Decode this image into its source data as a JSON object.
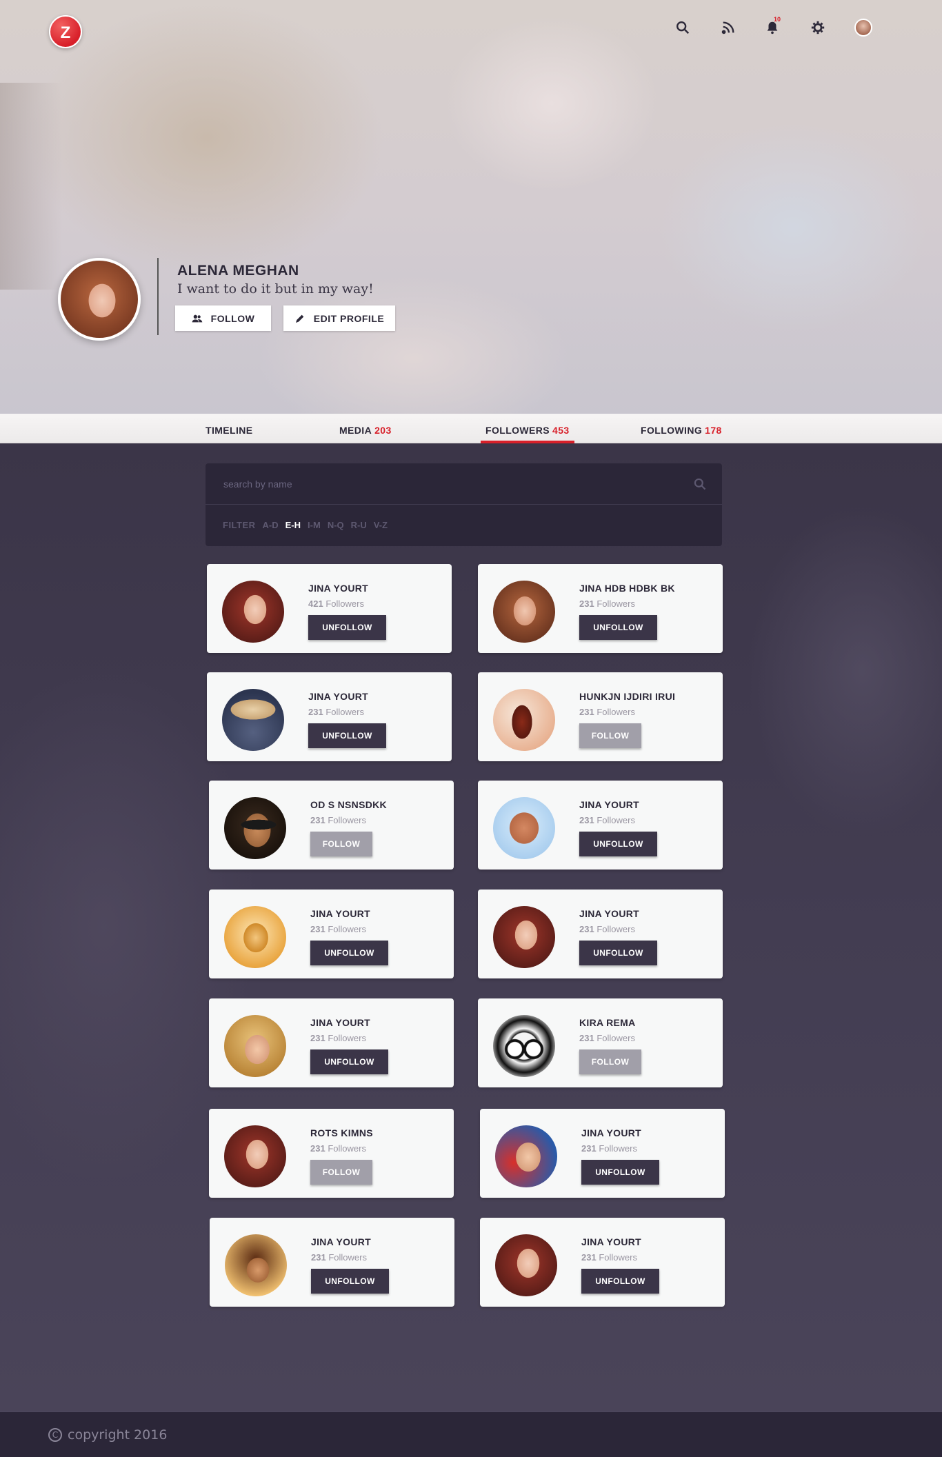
{
  "header": {
    "logo_letter": "Z",
    "notifications_count": "10",
    "icons": [
      "search-icon",
      "rss-icon",
      "bell-icon",
      "gear-icon",
      "avatar"
    ]
  },
  "profile": {
    "name": "ALENA MEGHAN",
    "tagline": "I want to do it but in my way!",
    "follow_label": "FOLLOW",
    "edit_label": "EDIT PROFILE"
  },
  "tabs": [
    {
      "label": "TIMELINE",
      "count": ""
    },
    {
      "label": "MEDIA",
      "count": "203"
    },
    {
      "label": "FOLLOWERS",
      "count": "453"
    },
    {
      "label": "FOLLOWING",
      "count": "178"
    }
  ],
  "active_tab": "FOLLOWERS",
  "search": {
    "placeholder": "search by name",
    "filter_label": "FILTER",
    "filters": [
      "A-D",
      "E-H",
      "I-M",
      "N-Q",
      "R-U",
      "V-Z"
    ],
    "active_filter": "E-H"
  },
  "followers_suffix": "Followers",
  "cards": [
    {
      "name": "JINA YOURT",
      "count": "421",
      "button": "UNFOLLOW",
      "avatar_style": "redhair"
    },
    {
      "name": "JINA HDB HDBK BK",
      "count": "231",
      "button": "UNFOLLOW",
      "avatar_style": "brown"
    },
    {
      "name": "JINA YOURT",
      "count": "231",
      "button": "UNFOLLOW",
      "avatar_style": "hat"
    },
    {
      "name": "HUNKJN IJDIRI IRUI",
      "count": "231",
      "button": "FOLLOW",
      "avatar_style": "silhouette"
    },
    {
      "name": "OD S NSNSDKK",
      "count": "231",
      "button": "FOLLOW",
      "avatar_style": "sunglasses"
    },
    {
      "name": "JINA YOURT",
      "count": "231",
      "button": "UNFOLLOW",
      "avatar_style": "hand"
    },
    {
      "name": "JINA YOURT",
      "count": "231",
      "button": "UNFOLLOW",
      "avatar_style": "golden"
    },
    {
      "name": "JINA YOURT",
      "count": "231",
      "button": "UNFOLLOW",
      "avatar_style": "redhair"
    },
    {
      "name": "JINA YOURT",
      "count": "231",
      "button": "UNFOLLOW",
      "avatar_style": "blonde"
    },
    {
      "name": "KIRA REMA",
      "count": "231",
      "button": "FOLLOW",
      "avatar_style": "sketch"
    },
    {
      "name": "ROTS KIMNS",
      "count": "231",
      "button": "FOLLOW",
      "avatar_style": "redhair"
    },
    {
      "name": "JINA YOURT",
      "count": "231",
      "button": "UNFOLLOW",
      "avatar_style": "smile"
    },
    {
      "name": "JINA YOURT",
      "count": "231",
      "button": "UNFOLLOW",
      "avatar_style": "windy"
    },
    {
      "name": "JINA YOURT",
      "count": "231",
      "button": "UNFOLLOW",
      "avatar_style": "redhair"
    }
  ],
  "footer": {
    "copyright": "copyright 2016"
  },
  "colors": {
    "accent": "#d8202a",
    "dark": "#2c2838",
    "panel": "#2b2638",
    "unfollow_button": "#3b3548",
    "follow_button": "#a19fa9"
  }
}
